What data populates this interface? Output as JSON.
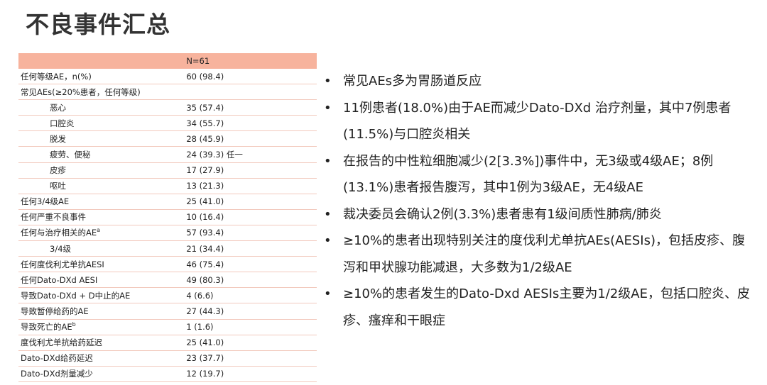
{
  "title": "不良事件汇总",
  "table": {
    "header": {
      "col1": "",
      "col2": "N=61"
    },
    "rows": [
      {
        "label": "任何等级AE，n(%)",
        "value": "60 (98.4)",
        "indent": 0
      },
      {
        "label": "常见AEs(≥20%患者，任何等级)",
        "value": "",
        "indent": 0
      },
      {
        "label": "恶心",
        "value": "35 (57.4)",
        "indent": 1
      },
      {
        "label": "口腔炎",
        "value": "34 (55.7)",
        "indent": 1
      },
      {
        "label": "脱发",
        "value": "28 (45.9)",
        "indent": 1
      },
      {
        "label": "疲劳、便秘",
        "value": "24 (39.3) 任一",
        "indent": 1
      },
      {
        "label": "皮疹",
        "value": "17 (27.9)",
        "indent": 1
      },
      {
        "label": "呕吐",
        "value": "13 (21.3)",
        "indent": 1
      },
      {
        "label": "任何3/4级AE",
        "value": "25 (41.0)",
        "indent": 0
      },
      {
        "label": "任何严重不良事件",
        "value": "10 (16.4)",
        "indent": 0
      },
      {
        "label": "任何与治疗相关的AE",
        "sup": "a",
        "value": "57 (93.4)",
        "indent": 0
      },
      {
        "label": "3/4级",
        "value": "21 (34.4)",
        "indent": 2
      },
      {
        "label": "任何度伐利尤单抗AESI",
        "value": "46 (75.4)",
        "indent": 0
      },
      {
        "label": "任何Dato-DXd AESI",
        "value": "49 (80.3)",
        "indent": 0
      },
      {
        "label": "导致Dato-DXd + D中止的AE",
        "value": "4 (6.6)",
        "indent": 0
      },
      {
        "label": "导致暂停给药的AE",
        "value": "27 (44.3)",
        "indent": 0
      },
      {
        "label": "导致死亡的AE",
        "sup": "b",
        "value": "1 (1.6)",
        "indent": 0
      },
      {
        "label": "度伐利尤单抗给药延迟",
        "value": "25 (41.0)",
        "indent": 0
      },
      {
        "label": "Dato-DXd给药延迟",
        "value": "23 (37.7)",
        "indent": 0
      },
      {
        "label": "Dato-DXd剂量减少",
        "value": "12 (19.7)",
        "indent": 0
      }
    ]
  },
  "bullets": [
    "常见AEs多为胃肠道反应",
    "11例患者(18.0%)由于AE而减少Dato-DXd 治疗剂量，其中7例患者(11.5%)与口腔炎相关",
    "在报告的中性粒细胞减少(2[3.3%])事件中，无3级或4级AE；8例(13.1%)患者报告腹泻，其中1例为3级AE，无4级AE",
    "裁决委员会确认2例(3.3%)患者患有1级间质性肺病/肺炎",
    "≥10%的患者出现特别关注的度伐利尤单抗AEs(AESIs)，包括皮疹、腹泻和甲状腺功能减退，大多数为1/2级AE",
    "≥10%的患者发生的Dato-Dxd AESIs主要为1/2级AE，包括口腔炎、皮疹、瘙痒和干眼症"
  ],
  "bullet_symbol": "•"
}
